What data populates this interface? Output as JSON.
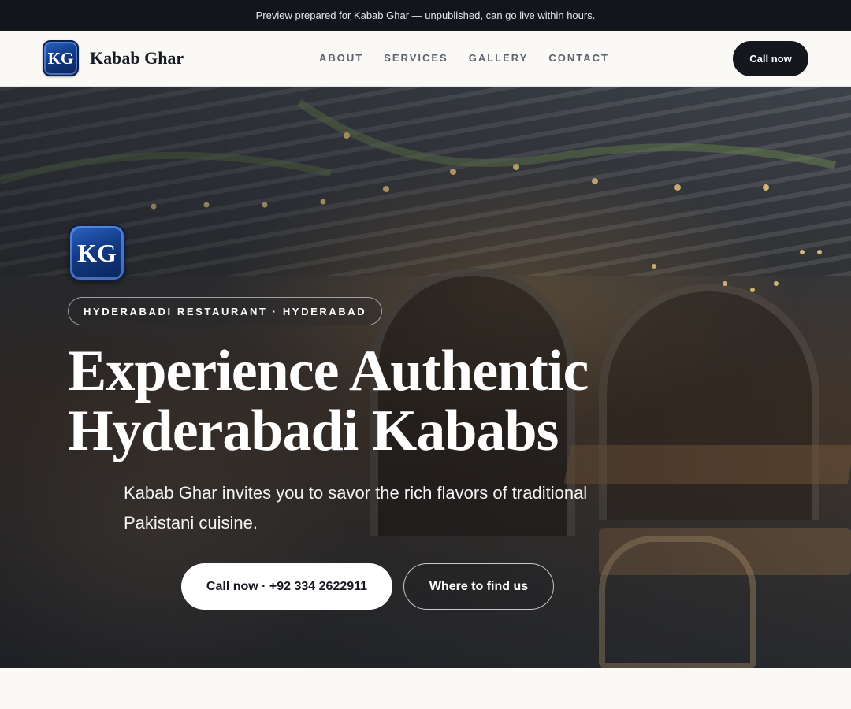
{
  "preview_banner": {
    "text": "Preview prepared for Kabab Ghar — unpublished, can go live within hours."
  },
  "header": {
    "logo_initials": "KG",
    "brand_name": "Kabab Ghar",
    "nav": [
      "ABOUT",
      "SERVICES",
      "GALLERY",
      "CONTACT"
    ],
    "cta_label": "Call now"
  },
  "hero": {
    "logo_initials": "KG",
    "eyebrow": "HYDERABADI RESTAURANT · HYDERABAD",
    "headline_line1": "Experience Authentic",
    "headline_line2": "Hyderabadi Kababs",
    "subtext": "Kab​ab Ghar invites you to savor the rich flavors of traditional Pakistani cuisine.",
    "primary_button": "Call now · +92 334 2622911",
    "secondary_button": "Where to find us"
  },
  "colors": {
    "banner_bg": "#12151b",
    "nav_bg": "#faf9f6",
    "cta_bg": "#14171e",
    "logo_blue": "#123b86"
  }
}
